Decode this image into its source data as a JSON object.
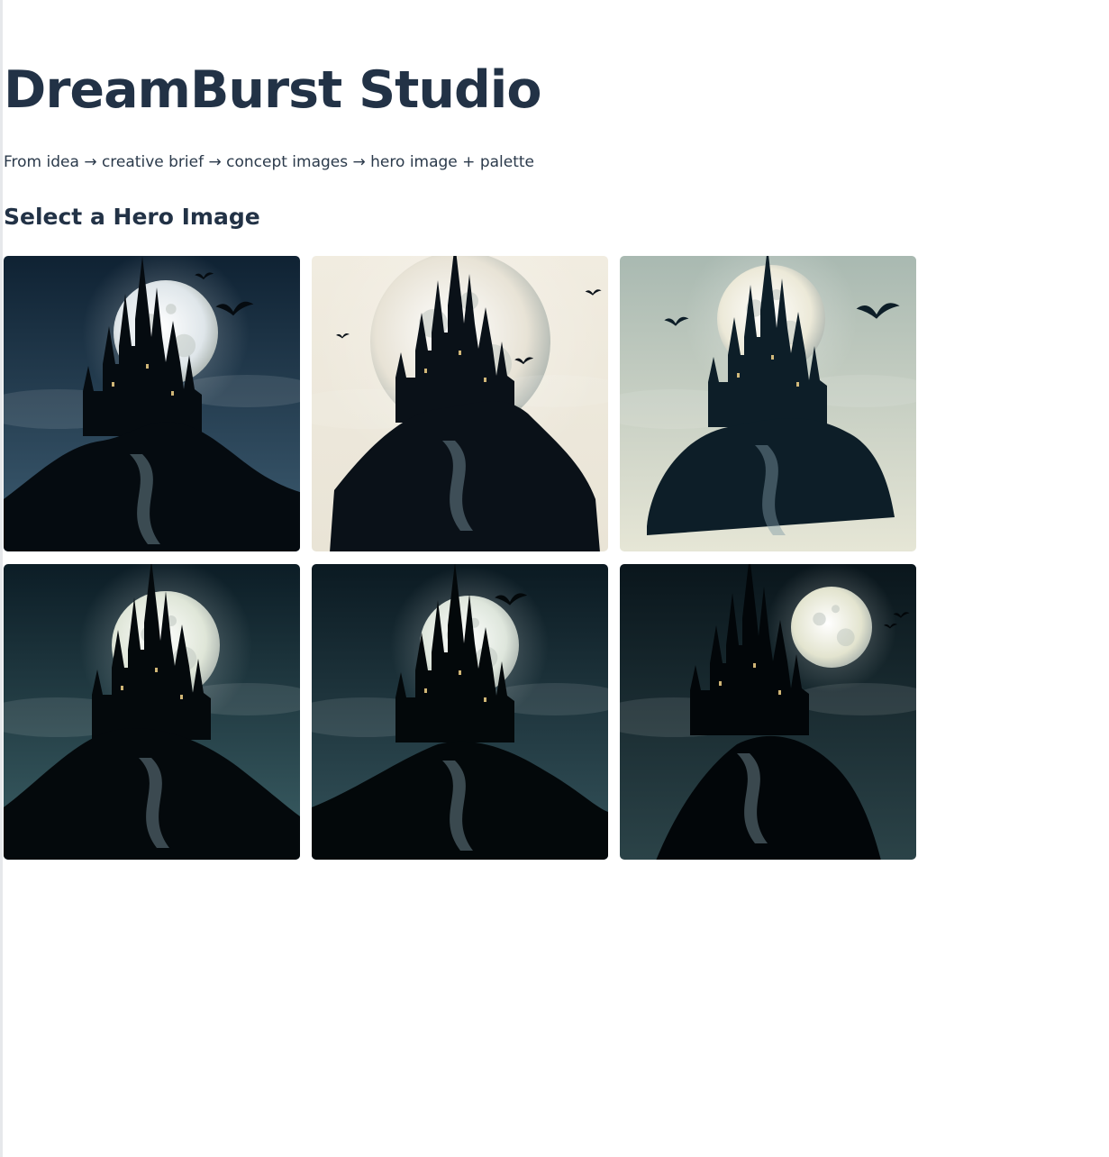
{
  "header": {
    "title": "DreamBurst Studio",
    "subtitle": "From idea → creative brief → concept images → hero image + palette"
  },
  "section": {
    "title": "Select a Hero Image"
  },
  "gallery": {
    "images": [
      {
        "theme": "night",
        "sky_top": "#0f2233",
        "sky_bottom": "#3e5d72",
        "moon": "#dfe6ea",
        "ink": "#050b10"
      },
      {
        "theme": "parchment",
        "sky_top": "#f1ece0",
        "sky_bottom": "#e9e4d6",
        "moon": "#e8e3d6",
        "ink": "#0a1118"
      },
      {
        "theme": "sage",
        "sky_top": "#a9b9b1",
        "sky_bottom": "#e6e6d6",
        "moon": "#ece9d8",
        "ink": "#0d1e28"
      },
      {
        "theme": "teal-night",
        "sky_top": "#0c1d26",
        "sky_bottom": "#3c6066",
        "moon": "#dfe6d8",
        "ink": "#04090c"
      },
      {
        "theme": "teal-night",
        "sky_top": "#0b1a22",
        "sky_bottom": "#35545c",
        "moon": "#dee6dc",
        "ink": "#03080a"
      },
      {
        "theme": "dark",
        "sky_top": "#0a161c",
        "sky_bottom": "#2b4348",
        "moon": "#e3e4cf",
        "ink": "#020609"
      }
    ]
  }
}
